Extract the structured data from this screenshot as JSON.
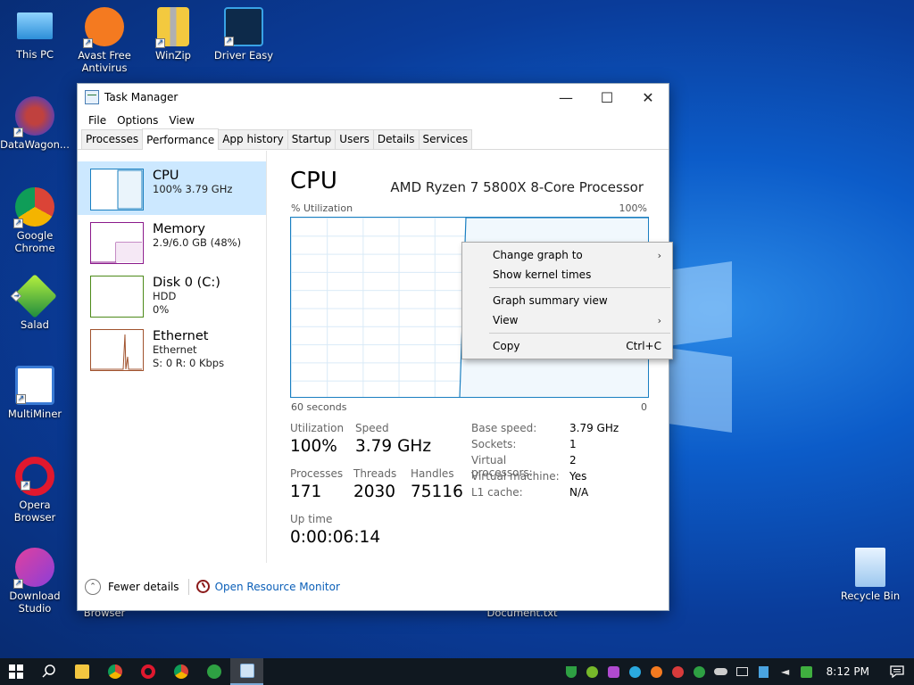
{
  "desktop": {
    "icons": [
      {
        "label": "This PC"
      },
      {
        "label": "Avast Free Antivirus"
      },
      {
        "label": "WinZip"
      },
      {
        "label": "Driver Easy"
      },
      {
        "label": "DataWagon..."
      },
      {
        "label": "Google Chrome"
      },
      {
        "label": "Salad"
      },
      {
        "label": "MultiMiner"
      },
      {
        "label": "Opera Browser"
      },
      {
        "label": "Download Studio"
      },
      {
        "label": "Recycle Bin"
      },
      {
        "label": "Browser"
      },
      {
        "label": "Document.txt"
      }
    ]
  },
  "window": {
    "title": "Task Manager",
    "minimize": "—",
    "maximize": "☐",
    "close": "✕"
  },
  "menu": {
    "file": "File",
    "options": "Options",
    "view": "View"
  },
  "tabs": [
    "Processes",
    "Performance",
    "App history",
    "Startup",
    "Users",
    "Details",
    "Services"
  ],
  "sidebar": {
    "items": [
      {
        "title": "CPU",
        "line1": "100%  3.79 GHz",
        "line2": "",
        "graph_color": "#1a7fc1"
      },
      {
        "title": "Memory",
        "line1": "2.9/6.0 GB (48%)",
        "line2": "",
        "graph_color": "#8b1a8b"
      },
      {
        "title": "Disk 0 (C:)",
        "line1": "HDD",
        "line2": "0%",
        "graph_color": "#4d8a1a"
      },
      {
        "title": "Ethernet",
        "line1": "Ethernet",
        "line2": "S: 0  R: 0 Kbps",
        "graph_color": "#a0522d"
      }
    ]
  },
  "cpu": {
    "title": "CPU",
    "processor": "AMD Ryzen 7 5800X 8-Core Processor",
    "util_label": "% Utilization",
    "util_max": "100%",
    "time_left": "60 seconds",
    "time_right": "0",
    "stats": {
      "utilization_label": "Utilization",
      "utilization": "100%",
      "speed_label": "Speed",
      "speed": "3.79 GHz",
      "processes_label": "Processes",
      "processes": "171",
      "threads_label": "Threads",
      "threads": "2030",
      "handles_label": "Handles",
      "handles": "75116",
      "uptime_label": "Up time",
      "uptime": "0:00:06:14"
    },
    "details": [
      {
        "key": "Base speed:",
        "value": "3.79 GHz"
      },
      {
        "key": "Sockets:",
        "value": "1"
      },
      {
        "key": "Virtual processors:",
        "value": "2"
      },
      {
        "key": "Virtual machine:",
        "value": "Yes"
      },
      {
        "key": "L1 cache:",
        "value": "N/A"
      }
    ]
  },
  "footer": {
    "fewer_details": "Fewer details",
    "resource_monitor": "Open Resource Monitor"
  },
  "context_menu": {
    "change_graph": "Change graph to",
    "kernel_times": "Show kernel times",
    "summary_view": "Graph summary view",
    "view": "View",
    "copy": "Copy",
    "copy_shortcut": "Ctrl+C"
  },
  "taskbar": {
    "clock": "8:12 PM"
  }
}
